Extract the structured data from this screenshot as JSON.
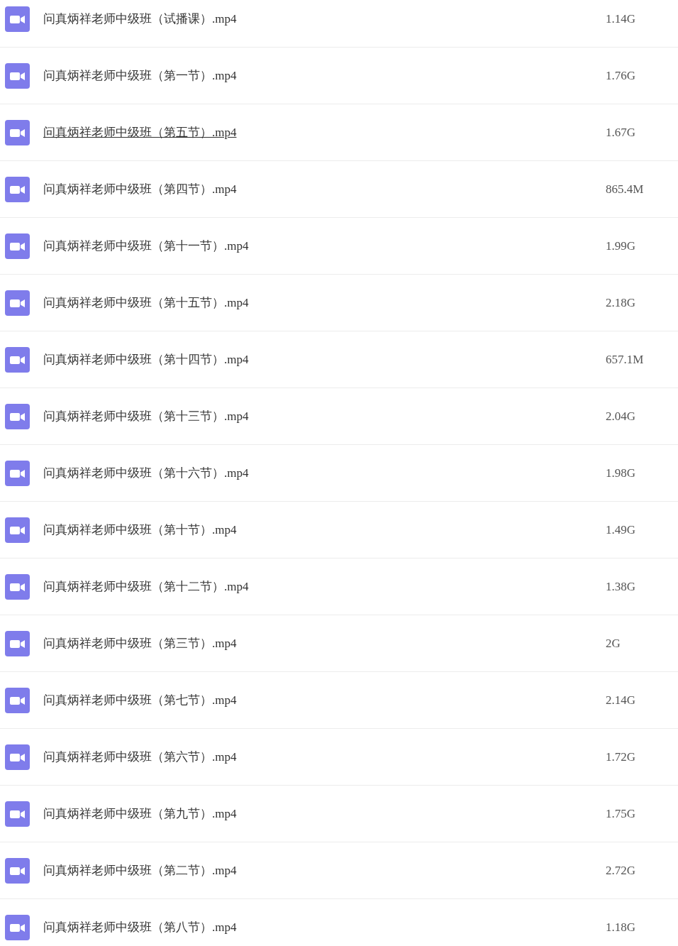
{
  "files": [
    {
      "name": "问真炳祥老师中级班（试播课）.mp4",
      "size": "1.14G",
      "hovered": false
    },
    {
      "name": "问真炳祥老师中级班（第一节）.mp4",
      "size": "1.76G",
      "hovered": false
    },
    {
      "name": "问真炳祥老师中级班（第五节）.mp4",
      "size": "1.67G",
      "hovered": true
    },
    {
      "name": "问真炳祥老师中级班（第四节）.mp4",
      "size": "865.4M",
      "hovered": false
    },
    {
      "name": "问真炳祥老师中级班（第十一节）.mp4",
      "size": "1.99G",
      "hovered": false
    },
    {
      "name": "问真炳祥老师中级班（第十五节）.mp4",
      "size": "2.18G",
      "hovered": false
    },
    {
      "name": "问真炳祥老师中级班（第十四节）.mp4",
      "size": "657.1M",
      "hovered": false
    },
    {
      "name": "问真炳祥老师中级班（第十三节）.mp4",
      "size": "2.04G",
      "hovered": false
    },
    {
      "name": "问真炳祥老师中级班（第十六节）.mp4",
      "size": "1.98G",
      "hovered": false
    },
    {
      "name": "问真炳祥老师中级班（第十节）.mp4",
      "size": "1.49G",
      "hovered": false
    },
    {
      "name": "问真炳祥老师中级班（第十二节）.mp4",
      "size": "1.38G",
      "hovered": false
    },
    {
      "name": "问真炳祥老师中级班（第三节）.mp4",
      "size": "2G",
      "hovered": false
    },
    {
      "name": "问真炳祥老师中级班（第七节）.mp4",
      "size": "2.14G",
      "hovered": false
    },
    {
      "name": "问真炳祥老师中级班（第六节）.mp4",
      "size": "1.72G",
      "hovered": false
    },
    {
      "name": "问真炳祥老师中级班（第九节）.mp4",
      "size": "1.75G",
      "hovered": false
    },
    {
      "name": "问真炳祥老师中级班（第二节）.mp4",
      "size": "2.72G",
      "hovered": false
    },
    {
      "name": "问真炳祥老师中级班（第八节）.mp4",
      "size": "1.18G",
      "hovered": false
    }
  ]
}
